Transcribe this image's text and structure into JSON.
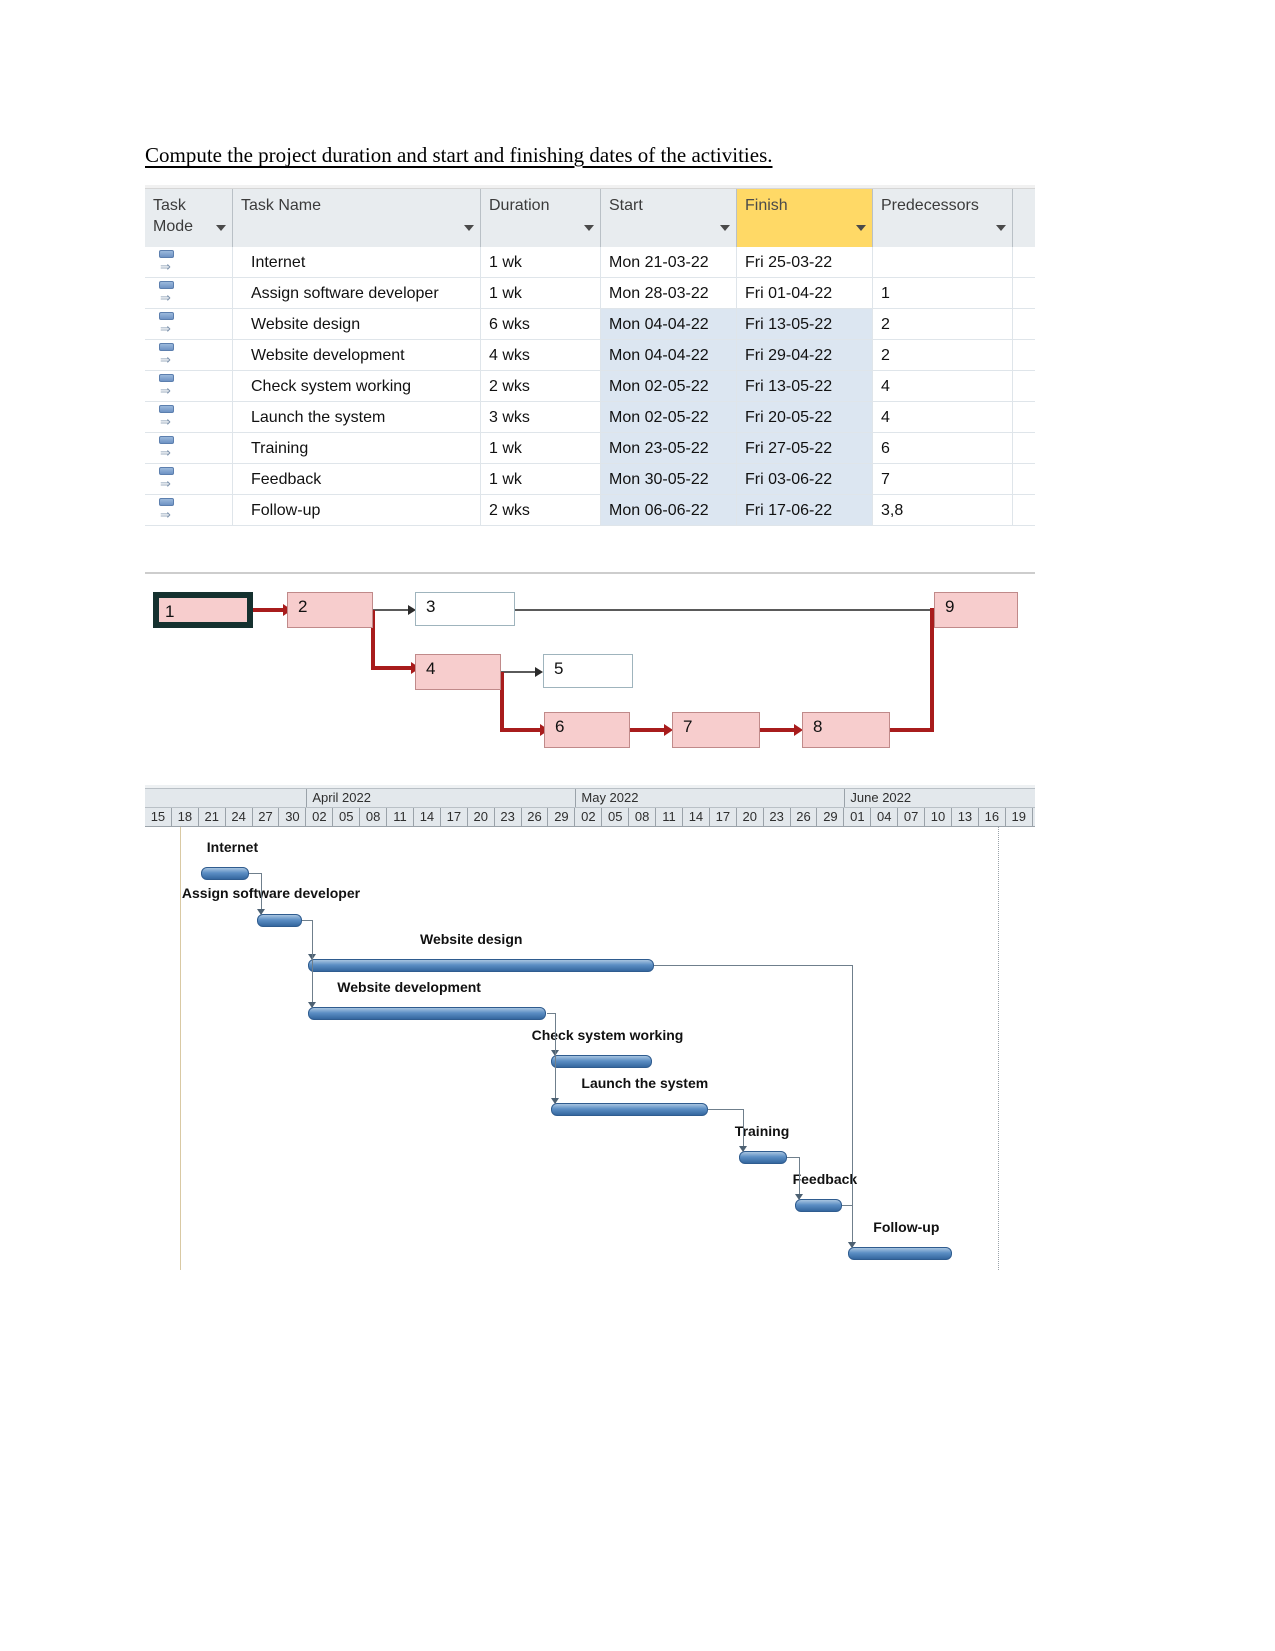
{
  "heading": "Compute the project duration and start and finishing dates of the activities.",
  "table": {
    "columns": [
      {
        "key": "mode",
        "label": "Task Mode",
        "caret": true,
        "highlight": false
      },
      {
        "key": "name",
        "label": "Task Name",
        "caret": true,
        "highlight": false
      },
      {
        "key": "duration",
        "label": "Duration",
        "caret": true,
        "highlight": false
      },
      {
        "key": "start",
        "label": "Start",
        "caret": true,
        "highlight": false
      },
      {
        "key": "finish",
        "label": "Finish",
        "caret": true,
        "highlight": true
      },
      {
        "key": "predecessors",
        "label": "Predecessors",
        "caret": true,
        "highlight": false
      }
    ],
    "rows": [
      {
        "id": 1,
        "name": "Internet",
        "duration": "1 wk",
        "start": "Mon 21-03-22",
        "finish": "Fri 25-03-22",
        "predecessors": "",
        "tinted": false
      },
      {
        "id": 2,
        "name": "Assign software developer",
        "duration": "1 wk",
        "start": "Mon 28-03-22",
        "finish": "Fri 01-04-22",
        "predecessors": "1",
        "tinted": false
      },
      {
        "id": 3,
        "name": "Website design",
        "duration": "6 wks",
        "start": "Mon 04-04-22",
        "finish": "Fri 13-05-22",
        "predecessors": "2",
        "tinted": true
      },
      {
        "id": 4,
        "name": "Website development",
        "duration": "4 wks",
        "start": "Mon 04-04-22",
        "finish": "Fri 29-04-22",
        "predecessors": "2",
        "tinted": true
      },
      {
        "id": 5,
        "name": "Check system working",
        "duration": "2 wks",
        "start": "Mon 02-05-22",
        "finish": "Fri 13-05-22",
        "predecessors": "4",
        "tinted": true
      },
      {
        "id": 6,
        "name": "Launch the system",
        "duration": "3 wks",
        "start": "Mon 02-05-22",
        "finish": "Fri 20-05-22",
        "predecessors": "4",
        "tinted": true
      },
      {
        "id": 7,
        "name": "Training",
        "duration": "1 wk",
        "start": "Mon 23-05-22",
        "finish": "Fri 27-05-22",
        "predecessors": "6",
        "tinted": true
      },
      {
        "id": 8,
        "name": "Feedback",
        "duration": "1 wk",
        "start": "Mon 30-05-22",
        "finish": "Fri 03-06-22",
        "predecessors": "7",
        "tinted": true
      },
      {
        "id": 9,
        "name": "Follow-up",
        "duration": "2 wks",
        "start": "Mon 06-06-22",
        "finish": "Fri 17-06-22",
        "predecessors": "3,8",
        "tinted": true
      }
    ]
  },
  "network": {
    "nodes": [
      {
        "id": "1",
        "label": "1",
        "critical": true,
        "selected": true
      },
      {
        "id": "2",
        "label": "2",
        "critical": true,
        "selected": false
      },
      {
        "id": "3",
        "label": "3",
        "critical": false,
        "selected": false
      },
      {
        "id": "4",
        "label": "4",
        "critical": true,
        "selected": false
      },
      {
        "id": "5",
        "label": "5",
        "critical": false,
        "selected": false
      },
      {
        "id": "6",
        "label": "6",
        "critical": true,
        "selected": false
      },
      {
        "id": "7",
        "label": "7",
        "critical": true,
        "selected": false
      },
      {
        "id": "8",
        "label": "8",
        "critical": true,
        "selected": false
      },
      {
        "id": "9",
        "label": "9",
        "critical": true,
        "selected": false
      }
    ],
    "links": [
      {
        "from": "1",
        "to": "2",
        "critical": true
      },
      {
        "from": "2",
        "to": "3",
        "critical": false
      },
      {
        "from": "2",
        "to": "4",
        "critical": true
      },
      {
        "from": "3",
        "to": "9",
        "critical": false
      },
      {
        "from": "4",
        "to": "5",
        "critical": false
      },
      {
        "from": "4",
        "to": "6",
        "critical": true
      },
      {
        "from": "6",
        "to": "7",
        "critical": true
      },
      {
        "from": "7",
        "to": "8",
        "critical": true
      },
      {
        "from": "8",
        "to": "9",
        "critical": true
      }
    ],
    "colors": {
      "critical": "#a81c1c",
      "normal": "#5a5a5a",
      "node_fill": "#f7cdcd",
      "node_plain": "#ffffff"
    }
  },
  "gantt": {
    "months": [
      {
        "label": "April 2022"
      },
      {
        "label": "May 2022"
      },
      {
        "label": "June 2022"
      }
    ],
    "days": [
      "15",
      "18",
      "21",
      "24",
      "27",
      "30",
      "02",
      "05",
      "08",
      "11",
      "14",
      "17",
      "20",
      "23",
      "26",
      "29",
      "02",
      "05",
      "08",
      "11",
      "14",
      "17",
      "20",
      "23",
      "26",
      "29",
      "01",
      "04",
      "07",
      "10",
      "13",
      "16",
      "19"
    ],
    "bars": [
      {
        "task": "Internet",
        "start": "Mon 21-03-22",
        "finish": "Fri 25-03-22",
        "duration": "1 wk"
      },
      {
        "task": "Assign software developer",
        "start": "Mon 28-03-22",
        "finish": "Fri 01-04-22",
        "duration": "1 wk"
      },
      {
        "task": "Website design",
        "start": "Mon 04-04-22",
        "finish": "Fri 13-05-22",
        "duration": "6 wks"
      },
      {
        "task": "Website development",
        "start": "Mon 04-04-22",
        "finish": "Fri 29-04-22",
        "duration": "4 wks"
      },
      {
        "task": "Check system working",
        "start": "Mon 02-05-22",
        "finish": "Fri 13-05-22",
        "duration": "2 wks"
      },
      {
        "task": "Launch the system",
        "start": "Mon 02-05-22",
        "finish": "Fri 20-05-22",
        "duration": "3 wks"
      },
      {
        "task": "Training",
        "start": "Mon 23-05-22",
        "finish": "Fri 27-05-22",
        "duration": "1 wk"
      },
      {
        "task": "Feedback",
        "start": "Mon 30-05-22",
        "finish": "Fri 03-06-22",
        "duration": "1 wk"
      },
      {
        "task": "Follow-up",
        "start": "Mon 06-06-22",
        "finish": "Fri 17-06-22",
        "duration": "2 wks"
      }
    ],
    "bar_color": "#4a7fb5"
  }
}
